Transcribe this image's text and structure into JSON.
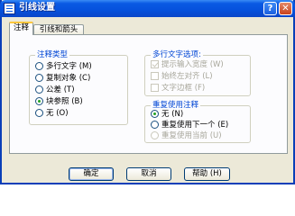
{
  "window": {
    "title": "引线设置",
    "help_button": "?",
    "close_button": "✕"
  },
  "tabs": [
    {
      "label": "注释",
      "active": true
    },
    {
      "label": "引线和箭头",
      "active": false
    }
  ],
  "annotation_type": {
    "label": "注释类型",
    "options": [
      {
        "label": "多行文字 (M)",
        "selected": false
      },
      {
        "label": "复制对象 (C)",
        "selected": false
      },
      {
        "label": "公差 (T)",
        "selected": false
      },
      {
        "label": "块参照 (B)",
        "selected": true
      },
      {
        "label": "无 (O)",
        "selected": false
      }
    ]
  },
  "mtext_options": {
    "label": "多行文字选项:",
    "options": [
      {
        "label": "提示输入宽度 (W)",
        "checked": true,
        "enabled": false
      },
      {
        "label": "始终左对齐 (L)",
        "checked": false,
        "enabled": false
      },
      {
        "label": "文字边框 (F)",
        "checked": false,
        "enabled": false
      }
    ]
  },
  "reuse_annotation": {
    "label": "重复使用注释",
    "options": [
      {
        "label": "无 (N)",
        "selected": true,
        "enabled": true
      },
      {
        "label": "重复使用下一个 (E)",
        "selected": false,
        "enabled": true
      },
      {
        "label": "重复使用当前 (U)",
        "selected": false,
        "enabled": false
      }
    ]
  },
  "buttons": {
    "ok": "确定",
    "cancel": "取消",
    "help": "帮助 (H)"
  },
  "colors": {
    "title_bar": "#0a5ae4",
    "dialog_bg": "#ece9d8",
    "group_label": "#0046d5",
    "disabled_text": "#a7a69a"
  }
}
